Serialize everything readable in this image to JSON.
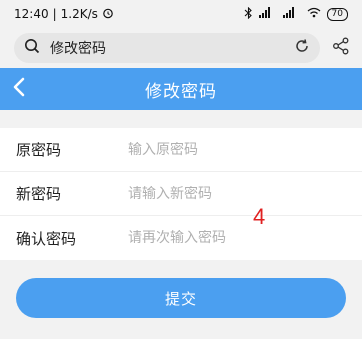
{
  "status_bar": {
    "time": "12:40",
    "network_speed": "1.2K/s",
    "battery": "70"
  },
  "search_bar": {
    "query": "修改密码",
    "icons": [
      "search-icon",
      "reload-icon",
      "share-icon"
    ]
  },
  "header": {
    "title": "修改密码",
    "color": "#4b9ff0"
  },
  "form": {
    "fields": [
      {
        "label": "原密码",
        "placeholder": "输入原密码"
      },
      {
        "label": "新密码",
        "placeholder": "请输入新密码"
      },
      {
        "label": "确认密码",
        "placeholder": "请再次输入密码"
      }
    ]
  },
  "annotation_marker": "4",
  "submit_label": "提交"
}
